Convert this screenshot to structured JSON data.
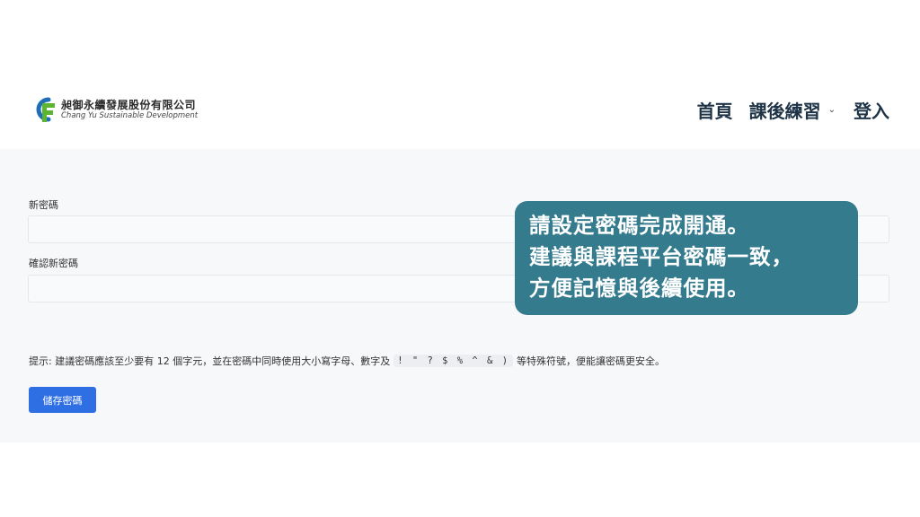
{
  "header": {
    "logo": {
      "company_cn": "昶御永續發展股份有限公司",
      "company_en": "Chang Yu Sustainable Development",
      "colors": {
        "blue": "#1f6fb8",
        "green": "#5cb531"
      }
    },
    "nav": {
      "home": "首頁",
      "courses": "課後練習",
      "login": "登入"
    }
  },
  "form": {
    "new_password_label": "新密碼",
    "confirm_password_label": "確認新密碼",
    "new_password_value": "",
    "confirm_password_value": "",
    "hint_prefix": "提示: 建議密碼應該至少要有 12 個字元，並在密碼中同時使用大小寫字母、數字及",
    "hint_chars": "! \" ? $ % ^ & )",
    "hint_suffix": "等特殊符號，便能讓密碼更安全。",
    "save_button": "儲存密碼"
  },
  "callout": {
    "line1": "請設定密碼完成開通。",
    "line2": "建議與課程平台密碼一致，",
    "line3": "方便記憶與後續使用。",
    "color": "#357b8e"
  }
}
